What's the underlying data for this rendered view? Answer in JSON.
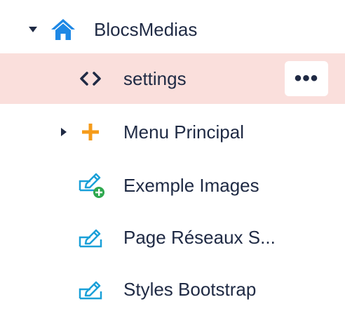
{
  "tree": {
    "root": {
      "label": "BlocsMedias",
      "icon": "home-icon",
      "expanded": true
    },
    "items": [
      {
        "label": "settings",
        "icon": "code-icon",
        "selected": true,
        "more_label": "•••"
      },
      {
        "label": "Menu Principal",
        "icon": "plus-icon",
        "expandable": true
      },
      {
        "label": "Exemple Images",
        "icon": "edit-add-icon"
      },
      {
        "label": "Page Réseaux S...",
        "icon": "edit-icon"
      },
      {
        "label": "Styles Bootstrap",
        "icon": "edit-icon"
      }
    ]
  },
  "colors": {
    "selected_bg": "#fadfdc",
    "text": "#1f2a44",
    "home_blue": "#1e88e5",
    "plus_orange": "#f59b1a",
    "edit_blue": "#1aa0d8",
    "add_green": "#2fa84f"
  }
}
